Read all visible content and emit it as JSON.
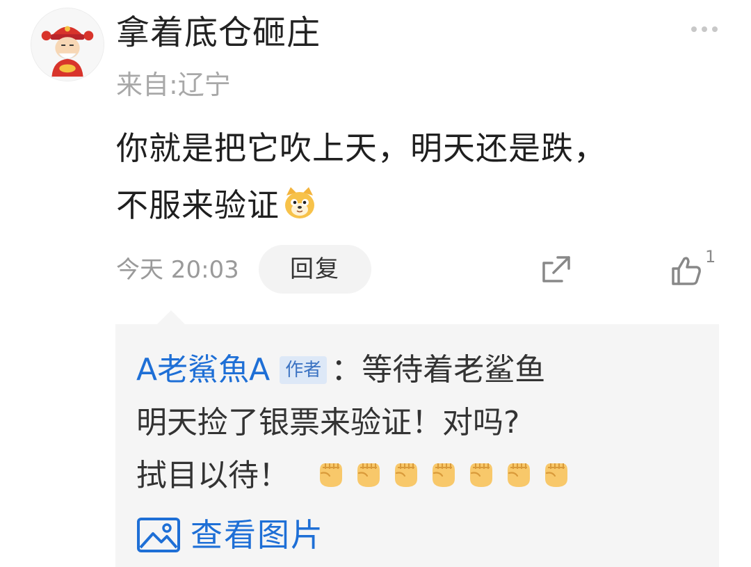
{
  "comment": {
    "username": "拿着底仓砸庄",
    "location": "来自:辽宁",
    "content_line1": "你就是把它吹上天，明天还是跌，",
    "content_line2": "不服来验证",
    "time": "今天 20:03",
    "reply_label": "回复",
    "like_count": "1"
  },
  "reply": {
    "author": "A老鯊魚A",
    "author_tag": "作者",
    "line1_text": "：等待着老鲨鱼",
    "line2_text": "明天捡了银票来验证！对吗?",
    "line3_text": "拭目以待！",
    "fist_count": 7,
    "view_pics_label": "查看图片"
  },
  "icons": {
    "more": "more-dots-icon",
    "share": "share-icon",
    "like": "thumbs-up-icon",
    "cat_emoji": "cat-emoji-icon",
    "fist": "fist-emoji-icon",
    "image": "image-icon"
  },
  "colors": {
    "link_blue": "#1e6fd6",
    "author_tag_bg": "#dde8f7",
    "reply_box_bg": "#f5f5f5",
    "secondary_text": "#9a9a9a"
  }
}
